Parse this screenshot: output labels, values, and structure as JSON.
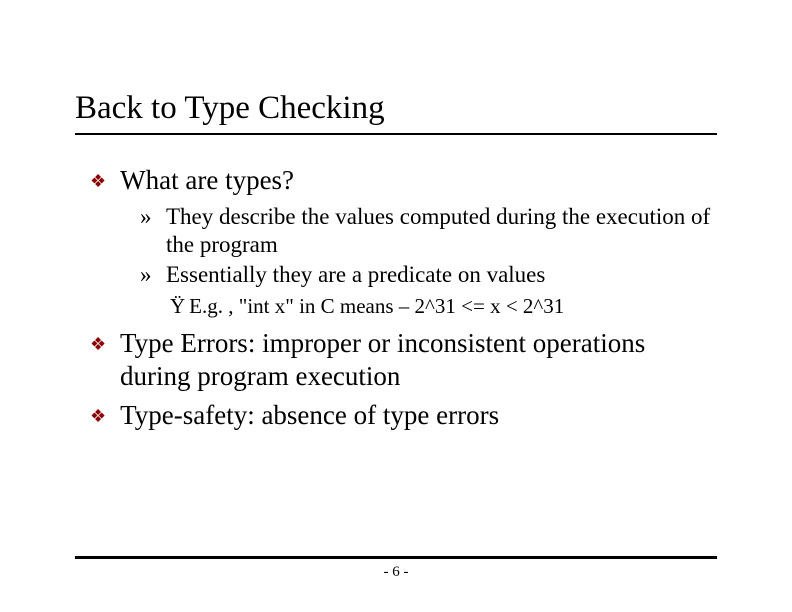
{
  "title": "Back to Type Checking",
  "bullets": {
    "b1": "What are types?",
    "b1_1": "They describe the values computed during the execution of the program",
    "b1_2": "Essentially they are a predicate on values",
    "b1_2_1": "E.g. , \"int x\" in C means – 2^31 <= x < 2^31",
    "b2": "Type Errors: improper or inconsistent operations during program execution",
    "b3": "Type-safety: absence of type errors"
  },
  "glyphs": {
    "diamond": "❖",
    "raquo": "»",
    "ydia": "Ÿ"
  },
  "page": "- 6 -"
}
